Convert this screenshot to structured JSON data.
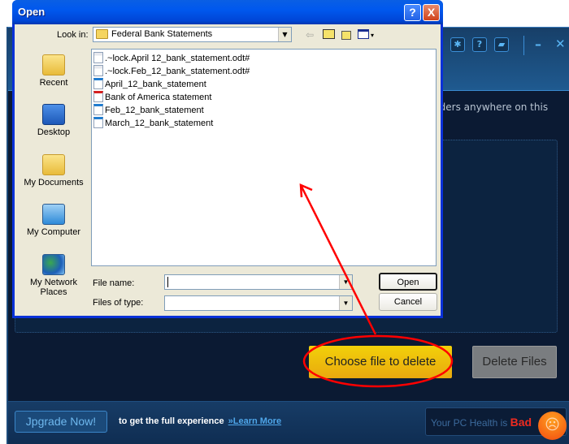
{
  "app": {
    "header_icons": [
      "gear-icon",
      "help-icon",
      "feedback-icon"
    ],
    "header_icon_glyphs": {
      "gear": "✱",
      "help": "?",
      "feedback": "▰"
    },
    "minimize_glyph": "–",
    "close_glyph": "✕",
    "description_fragment": "olders anywhere on this",
    "choose_button": "Choose file to delete",
    "delete_button": "Delete Files",
    "footer": {
      "upgrade_button": "Jpgrade Now!",
      "promo_text": "to get the full experience",
      "learn_more": "»Learn More",
      "health_prefix": "Your PC Health is",
      "health_status": "Bad",
      "health_icon_glyph": "☹"
    },
    "colors": {
      "accent_yellow": "#f2d10a",
      "bad_red": "#ee2b20",
      "link_blue": "#4fa7ea",
      "bg_dark": "#0b1a33"
    }
  },
  "dialog": {
    "title": "Open",
    "help_glyph": "?",
    "close_glyph": "X",
    "look_in_label": "Look in:",
    "look_in_value": "Federal Bank Statements",
    "toolbar": {
      "back_glyph": "⇦",
      "up_glyph": "⤴",
      "views_arrow": "▾"
    },
    "places": [
      {
        "label": "Recent",
        "icon": "recent-folder-icon"
      },
      {
        "label": "Desktop",
        "icon": "desktop-icon"
      },
      {
        "label": "My Documents",
        "icon": "my-documents-icon"
      },
      {
        "label": "My Computer",
        "icon": "my-computer-icon"
      },
      {
        "label": "My Network Places",
        "icon": "network-places-icon"
      }
    ],
    "files": [
      {
        "name": ".~lock.April 12_bank_statement.odt#",
        "type": "odt"
      },
      {
        "name": ".~lock.Feb_12_bank_statement.odt#",
        "type": "odt"
      },
      {
        "name": "April_12_bank_statement",
        "type": "doc"
      },
      {
        "name": "Bank of America statement",
        "type": "pdf"
      },
      {
        "name": "Feb_12_bank_statement",
        "type": "doc"
      },
      {
        "name": "March_12_bank_statement",
        "type": "doc"
      }
    ],
    "file_name_label": "File name:",
    "file_name_value": "",
    "files_of_type_label": "Files of type:",
    "files_of_type_value": "",
    "dropdown_glyph": "▼",
    "open_button": "Open",
    "cancel_button": "Cancel"
  },
  "annotation": {
    "color": "#ff0000",
    "type": "arrow-and-ellipse"
  }
}
